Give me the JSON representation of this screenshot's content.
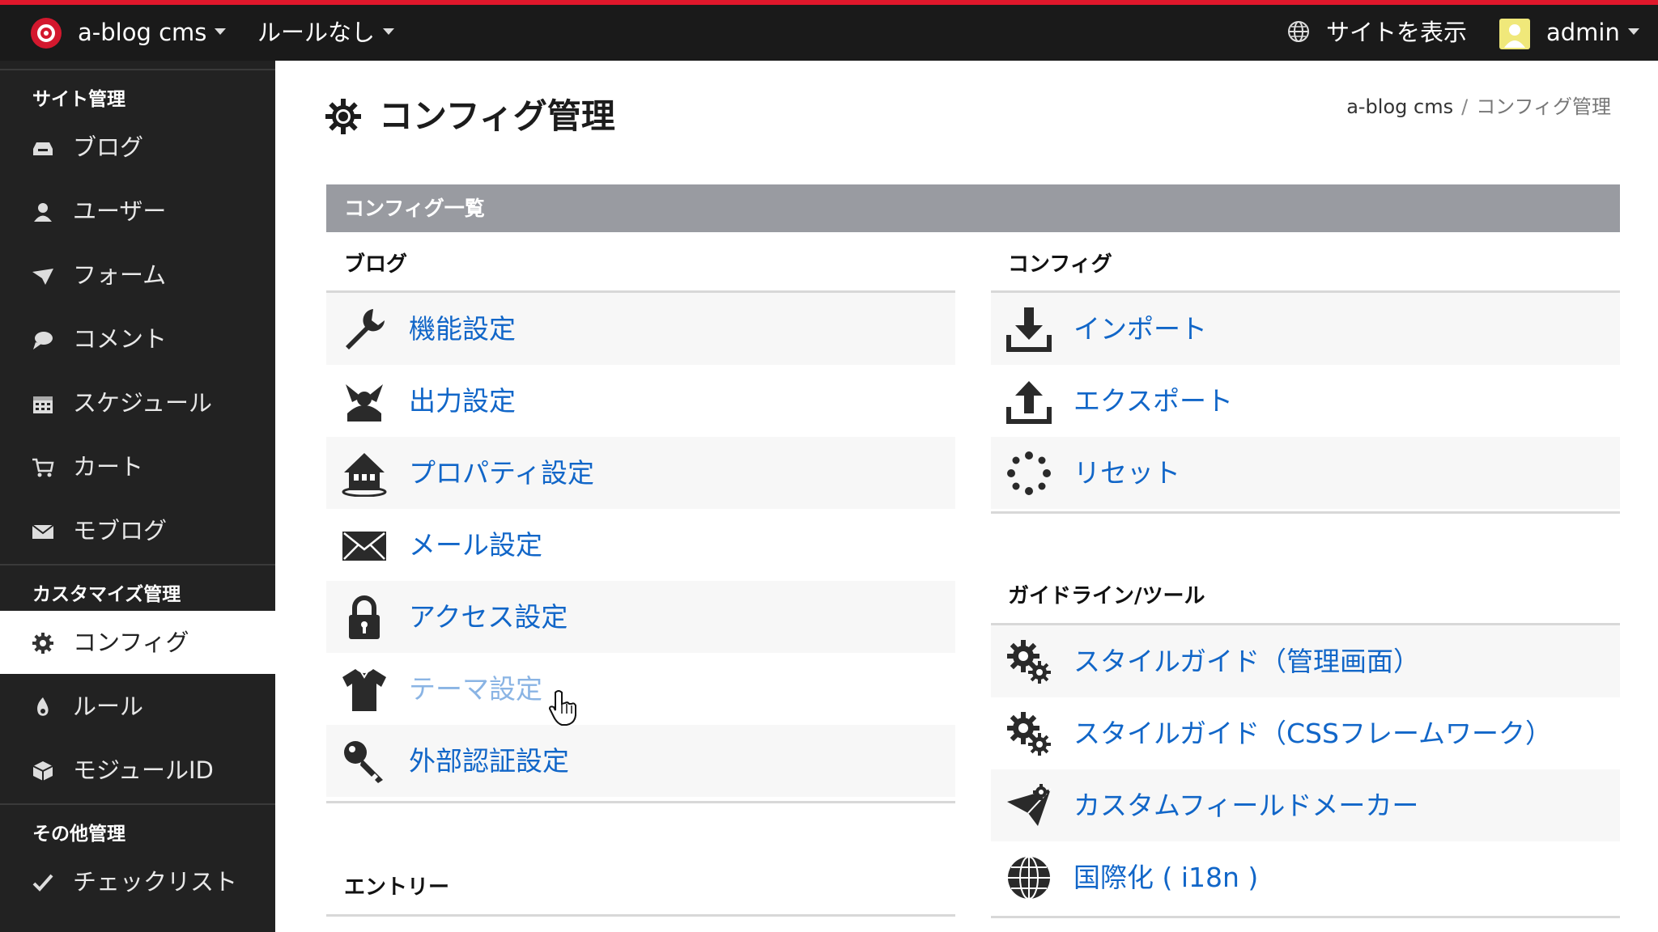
{
  "topbar": {
    "site_name": "a-blog cms",
    "rule_menu": "ルールなし",
    "view_site": "サイトを表示",
    "user": "admin"
  },
  "sidebar": {
    "section_site": "サイト管理",
    "site_items": [
      {
        "label": "ブログ",
        "icon": "inbox-icon"
      },
      {
        "label": "ユーザー",
        "icon": "user-icon"
      },
      {
        "label": "フォーム",
        "icon": "form-icon"
      },
      {
        "label": "コメント",
        "icon": "comment-icon"
      },
      {
        "label": "スケジュール",
        "icon": "calendar-icon"
      },
      {
        "label": "カート",
        "icon": "cart-icon"
      },
      {
        "label": "モブログ",
        "icon": "mail-icon"
      }
    ],
    "section_custom": "カスタマイズ管理",
    "custom_items": [
      {
        "label": "コンフィグ",
        "icon": "gear-icon",
        "active": true
      },
      {
        "label": "ルール",
        "icon": "rule-icon"
      },
      {
        "label": "モジュールID",
        "icon": "module-icon"
      }
    ],
    "section_other": "その他管理",
    "other_items": [
      {
        "label": "チェックリスト",
        "icon": "check-icon"
      }
    ]
  },
  "main": {
    "title": "コンフィグ管理",
    "breadcrumb": {
      "root": "a-blog cms",
      "sep": "/",
      "current": "コンフィグ管理"
    },
    "panel_title": "コンフィグ一覧",
    "blog": {
      "title": "ブログ",
      "items": [
        {
          "label": "機能設定",
          "icon": "wrench-icon"
        },
        {
          "label": "出力設定",
          "icon": "output-icon"
        },
        {
          "label": "プロパティ設定",
          "icon": "house-icon"
        },
        {
          "label": "メール設定",
          "icon": "envelope-icon"
        },
        {
          "label": "アクセス設定",
          "icon": "lock-icon"
        },
        {
          "label": "テーマ設定",
          "icon": "shirt-icon",
          "hover": true
        },
        {
          "label": "外部認証設定",
          "icon": "key-icon"
        }
      ]
    },
    "entry": {
      "title": "エントリー"
    },
    "config": {
      "title": "コンフィグ",
      "items": [
        {
          "label": "インポート",
          "icon": "download-icon"
        },
        {
          "label": "エクスポート",
          "icon": "upload-icon"
        },
        {
          "label": "リセット",
          "icon": "spinner-icon"
        }
      ]
    },
    "guide": {
      "title": "ガイドライン/ツール",
      "items": [
        {
          "label": "スタイルガイド（管理画面）",
          "icon": "gears-icon"
        },
        {
          "label": "スタイルガイド（CSSフレームワーク）",
          "icon": "gears-icon"
        },
        {
          "label": "カスタムフィールドメーカー",
          "icon": "paper-plane-icon"
        },
        {
          "label": "国際化 ( i18n )",
          "icon": "globe-icon"
        }
      ]
    }
  },
  "colors": {
    "accent": "#e0172b",
    "link": "#1166c8",
    "sidebar": "#222222",
    "panel_head": "#999ba1"
  }
}
